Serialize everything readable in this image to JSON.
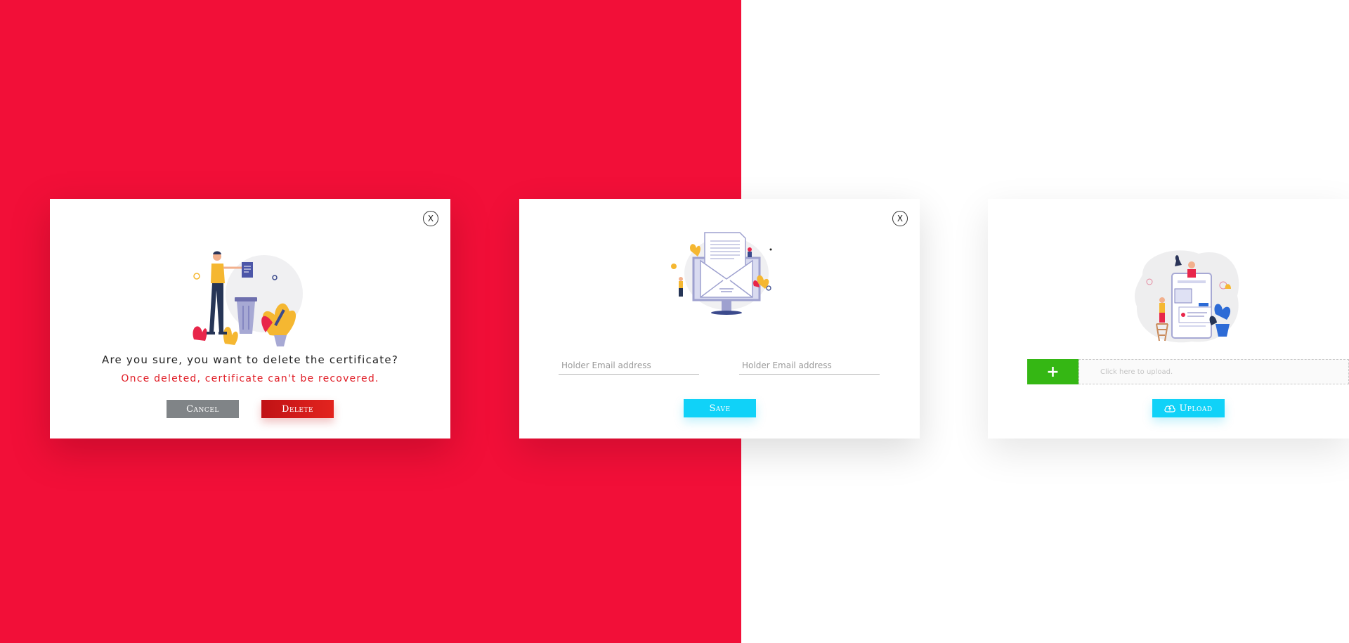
{
  "colors": {
    "background_red": "#f20f38",
    "delete_red": "#e3241f",
    "warning_red": "#e01b24",
    "cancel_gray": "#808487",
    "cyan_accent": "#10d2f8",
    "add_green": "#35b714"
  },
  "delete_modal": {
    "close_label": "X",
    "question": "Are you sure, you want to delete the certificate?",
    "warning": "Once deleted, certificate can't be recovered.",
    "cancel_label": "Cancel",
    "delete_label": "Delete",
    "illustration_icon": "person-trash-bin-illustration"
  },
  "email_modal": {
    "close_label": "X",
    "field1_placeholder": "Holder Email address",
    "field2_placeholder": "Holder Email address",
    "save_label": "Save",
    "illustration_icon": "envelope-monitor-illustration"
  },
  "upload_modal": {
    "add_label": "+",
    "upload_placeholder": "Click here to upload.",
    "upload_label": "Upload",
    "upload_icon": "cloud-upload-icon",
    "illustration_icon": "phone-upload-illustration"
  }
}
